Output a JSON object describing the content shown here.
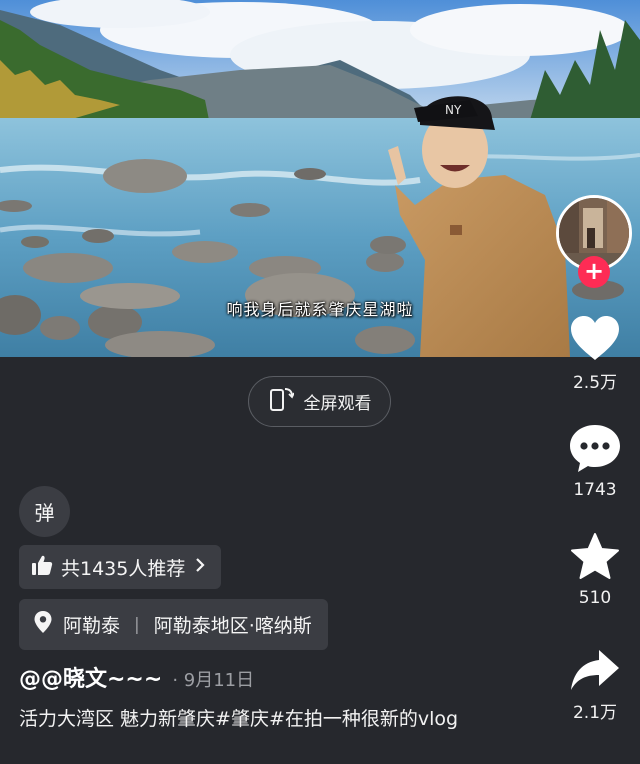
{
  "video": {
    "subtitle": "响我身后就系肇庆星湖啦"
  },
  "fullscreen": {
    "label": "全屏观看",
    "icon": "rotate-screen-icon"
  },
  "danmu": {
    "label": "弹"
  },
  "recommend": {
    "label": "共1435人推荐",
    "icon": "thumbs-up-icon"
  },
  "location": {
    "primary": "阿勒泰",
    "secondary": "阿勒泰地区·喀纳斯",
    "icon": "location-pin-icon"
  },
  "author": {
    "name": "@@晓文~~~",
    "date": "9月11日"
  },
  "caption": {
    "text": "活力大湾区  魅力新肇庆#肇庆#在拍一种很新的vlog"
  },
  "actions": {
    "follow_symbol": "+",
    "like_count": "2.5万",
    "comment_count": "1743",
    "favorite_count": "510",
    "share_count": "2.1万"
  },
  "colors": {
    "background": "#26282d",
    "follow_accent": "#fe2c55",
    "chip_bg": "#3b3d43"
  }
}
